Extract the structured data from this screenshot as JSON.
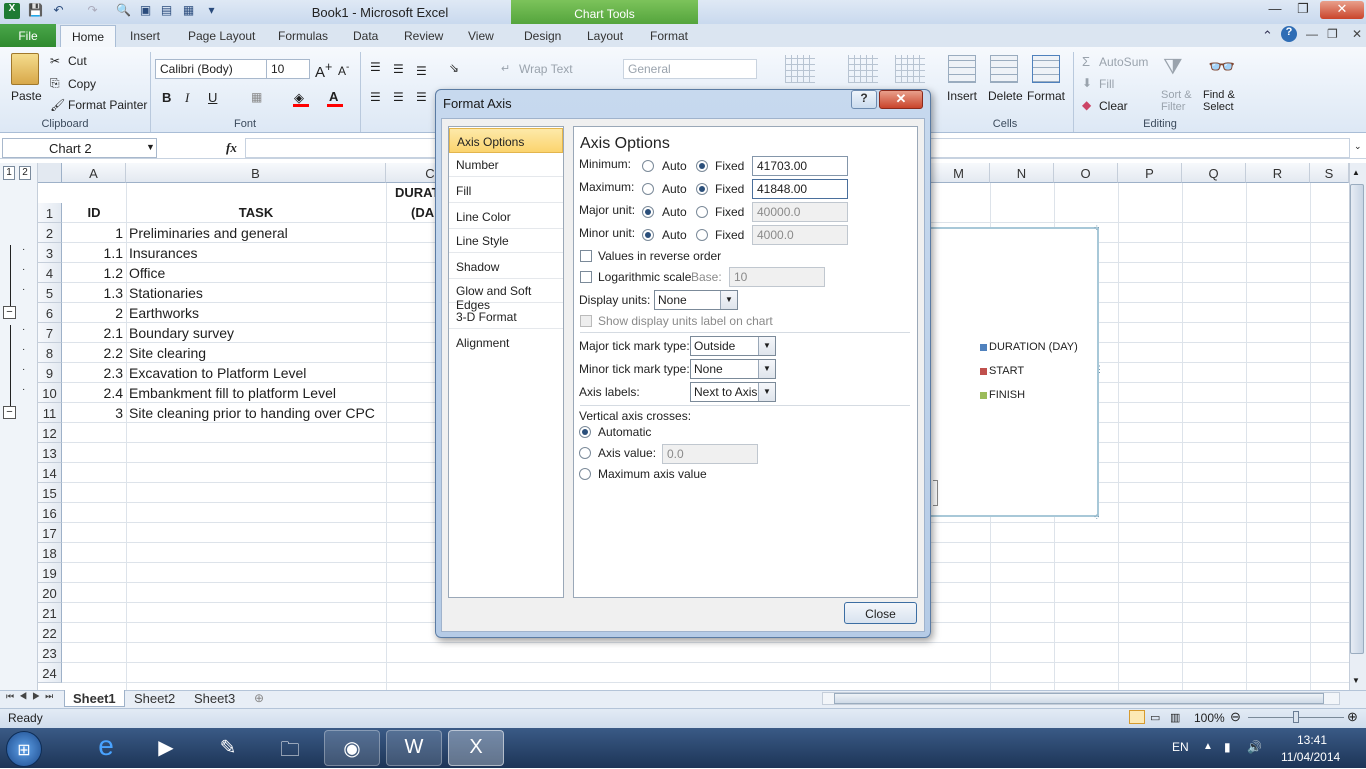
{
  "window": {
    "title": "Book1  -  Microsoft Excel",
    "chart_tools": "Chart Tools"
  },
  "tabs": {
    "file": "File",
    "home": "Home",
    "insert": "Insert",
    "page_layout": "Page Layout",
    "formulas": "Formulas",
    "data": "Data",
    "review": "Review",
    "view": "View",
    "design": "Design",
    "layout": "Layout",
    "format": "Format"
  },
  "ribbon": {
    "paste": "Paste",
    "cut": "Cut",
    "copy": "Copy",
    "format_painter": "Format Painter",
    "clipboard": "Clipboard",
    "font_name": "Calibri (Body)",
    "font_size": "10",
    "font": "Font",
    "wrap_text": "Wrap Text",
    "number_format": "General",
    "insert": "Insert",
    "delete": "Delete",
    "format": "Format",
    "cells": "Cells",
    "autosum": "AutoSum",
    "fill": "Fill",
    "clear": "Clear",
    "sort_filter": "Sort & Filter",
    "find_select": "Find & Select",
    "editing": "Editing"
  },
  "formula_bar": {
    "name_box": "Chart 2",
    "fx": "fx"
  },
  "columns": [
    "A",
    "B",
    "C",
    "M",
    "N",
    "O",
    "P",
    "Q",
    "R",
    "S"
  ],
  "header_row": {
    "id": "ID",
    "task": "TASK",
    "duration1": "DURAT",
    "duration2": "(DA"
  },
  "rows": [
    "1",
    "2",
    "3",
    "4",
    "5",
    "6",
    "7",
    "8",
    "9",
    "10",
    "11",
    "12",
    "13",
    "14",
    "15",
    "16",
    "17",
    "18",
    "19",
    "20",
    "21",
    "22",
    "23",
    "24"
  ],
  "data_rows": [
    {
      "id": "1",
      "task": "Preliminaries and general"
    },
    {
      "id": "1.1",
      "task": "Insurances"
    },
    {
      "id": "1.2",
      "task": "Office"
    },
    {
      "id": "1.3",
      "task": "Stationaries"
    },
    {
      "id": "2",
      "task": "Earthworks"
    },
    {
      "id": "2.1",
      "task": "Boundary survey"
    },
    {
      "id": "2.2",
      "task": "Site clearing"
    },
    {
      "id": "2.3",
      "task": "Excavation to Platform Level"
    },
    {
      "id": "2.4",
      "task": "Embankment fill to platform Level"
    },
    {
      "id": "3",
      "task": "Site cleaning prior to handing over CPC"
    }
  ],
  "legend": [
    {
      "label": "DURATION (DAY)",
      "color": "#4f81bd"
    },
    {
      "label": "START",
      "color": "#c0504d"
    },
    {
      "label": "FINISH",
      "color": "#9bbb59"
    }
  ],
  "sheet_tabs": [
    "Sheet1",
    "Sheet2",
    "Sheet3"
  ],
  "status": {
    "ready": "Ready",
    "zoom": "100%"
  },
  "taskbar": {
    "lang": "EN",
    "time": "13:41",
    "date": "11/04/2014"
  },
  "dialog": {
    "title": "Format Axis",
    "nav": [
      "Axis Options",
      "Number",
      "Fill",
      "Line Color",
      "Line Style",
      "Shadow",
      "Glow and Soft Edges",
      "3-D Format",
      "Alignment"
    ],
    "heading": "Axis Options",
    "minimum": "Minimum:",
    "maximum": "Maximum:",
    "major_unit": "Major unit:",
    "minor_unit": "Minor unit:",
    "auto": "Auto",
    "fixed": "Fixed",
    "min_value": "41703.00",
    "max_value": "41848.00",
    "major_value": "40000.0",
    "minor_value": "4000.0",
    "reverse_order": "Values in reverse order",
    "log_scale": "Logarithmic scale",
    "base": "Base:",
    "base_value": "10",
    "display_units": "Display units:",
    "display_units_value": "None",
    "show_units_label": "Show display units label on chart",
    "major_tick": "Major tick mark type:",
    "major_tick_value": "Outside",
    "minor_tick": "Minor tick mark type:",
    "minor_tick_value": "None",
    "axis_labels": "Axis labels:",
    "axis_labels_value": "Next to Axis",
    "vertical_crosses": "Vertical axis crosses:",
    "automatic": "Automatic",
    "axis_value": "Axis value:",
    "axis_value_value": "0.0",
    "max_axis_value": "Maximum axis value",
    "close": "Close"
  }
}
